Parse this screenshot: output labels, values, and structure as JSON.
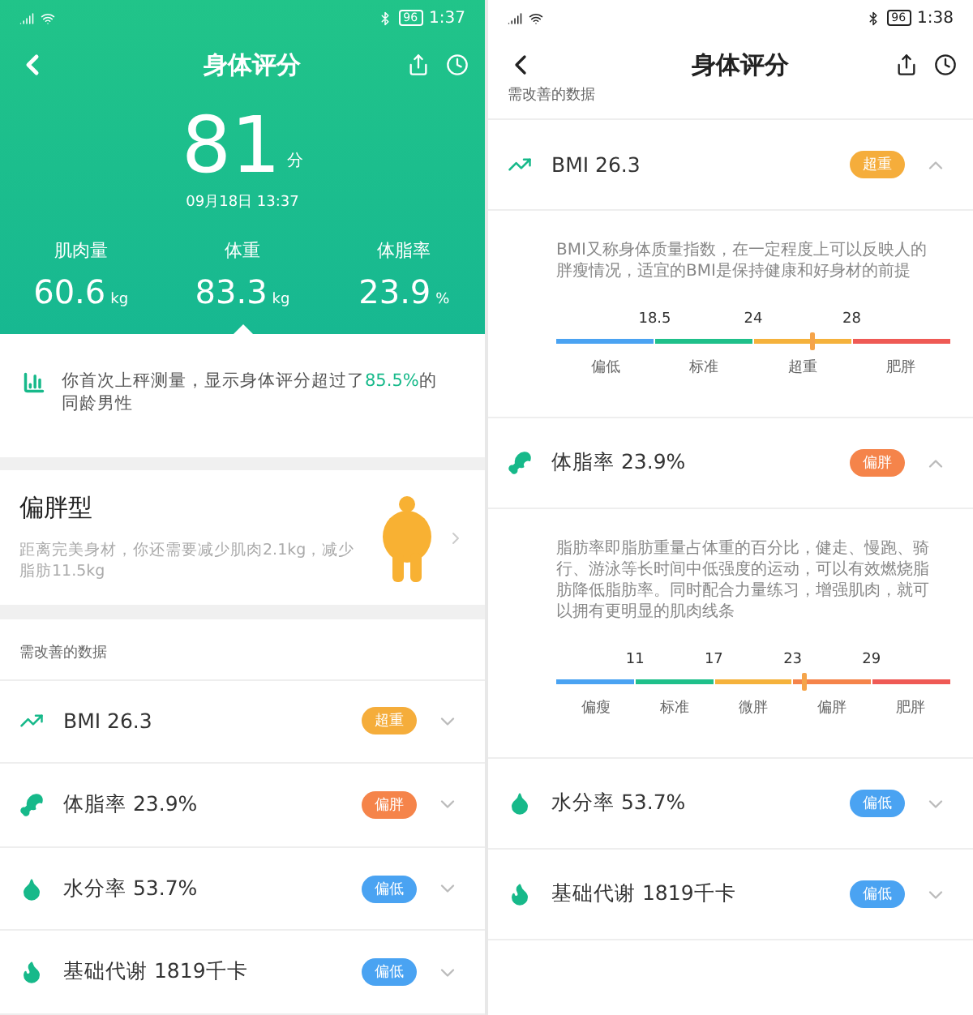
{
  "screens": [
    {
      "kind": "summary",
      "status_bar": {
        "time": "1:37",
        "battery": "96"
      },
      "header": {
        "title": "身体评分"
      },
      "score": {
        "value": "81",
        "unit": "分",
        "date": "09月18日 13:37"
      },
      "stats": [
        {
          "label": "肌肉量",
          "value": "60.6",
          "unit": "kg",
          "selected": false
        },
        {
          "label": "体重",
          "value": "83.3",
          "unit": "kg",
          "selected": true
        },
        {
          "label": "体脂率",
          "value": "23.9",
          "unit": "%",
          "selected": false
        }
      ],
      "insight": "你首次上秤测量，显示身体评分超过了**85.5%**的同龄男性",
      "body_type": {
        "title": "偏胖型",
        "description": "距离完美身材，你还需要减少肌肉2.1kg，减少脂肪11.5kg"
      },
      "section_label": "需改善的数据",
      "metrics": [
        {
          "kind": "trend",
          "name": "BMI 26.3",
          "badge": "超重",
          "color": "#f5ad3b",
          "expanded": false
        },
        {
          "kind": "drumstick",
          "name": "体脂率 23.9%",
          "badge": "偏胖",
          "color": "#f5844a",
          "expanded": false
        },
        {
          "kind": "drop",
          "name": "水分率 53.7%",
          "badge": "偏低",
          "color": "#4aa3f2",
          "expanded": false
        },
        {
          "kind": "flame",
          "name": "基础代谢 1819千卡",
          "badge": "偏低",
          "color": "#4aa3f2",
          "expanded": false
        }
      ]
    },
    {
      "kind": "details",
      "status_bar": {
        "time": "1:38",
        "battery": "96"
      },
      "header": {
        "title": "身体评分"
      },
      "section_label": "需改善的数据",
      "metrics": [
        {
          "kind": "trend",
          "name": "BMI 26.3",
          "badge": "超重",
          "color": "#f5ad3b",
          "expanded": true,
          "description": "BMI又称身体质量指数，在一定程度上可以反映人的胖瘦情况，适宜的BMI是保持健康和好身材的前提",
          "scale": {
            "ticks": [
              "18.5",
              "24",
              "28"
            ],
            "segments": [
              {
                "label": "偏低",
                "color": "#4aa3f2"
              },
              {
                "label": "标准",
                "color": "#1fc08a"
              },
              {
                "label": "超重",
                "color": "#f5b23c"
              },
              {
                "label": "肥胖",
                "color": "#ef5a55"
              }
            ],
            "level": 0.65
          }
        },
        {
          "kind": "drumstick",
          "name": "体脂率 23.9%",
          "badge": "偏胖",
          "color": "#f5844a",
          "expanded": true,
          "description": "脂肪率即脂肪重量占体重的百分比，健走、慢跑、骑行、游泳等长时间中低强度的运动，可以有效燃烧脂肪降低脂肪率。同时配合力量练习，增强肌肉，就可以拥有更明显的肌肉线条",
          "scale": {
            "ticks": [
              "11",
              "17",
              "23",
              "29"
            ],
            "segments": [
              {
                "label": "偏瘦",
                "color": "#4aa3f2"
              },
              {
                "label": "标准",
                "color": "#1fc08a"
              },
              {
                "label": "微胖",
                "color": "#f5b23c"
              },
              {
                "label": "偏胖",
                "color": "#f5844a"
              },
              {
                "label": "肥胖",
                "color": "#ef5a55"
              }
            ],
            "level": 0.63
          }
        },
        {
          "kind": "drop",
          "name": "水分率 53.7%",
          "badge": "偏低",
          "color": "#4aa3f2",
          "expanded": false
        },
        {
          "kind": "flame",
          "name": "基础代谢 1819千卡",
          "badge": "偏低",
          "color": "#4aa3f2",
          "expanded": false
        }
      ]
    }
  ]
}
